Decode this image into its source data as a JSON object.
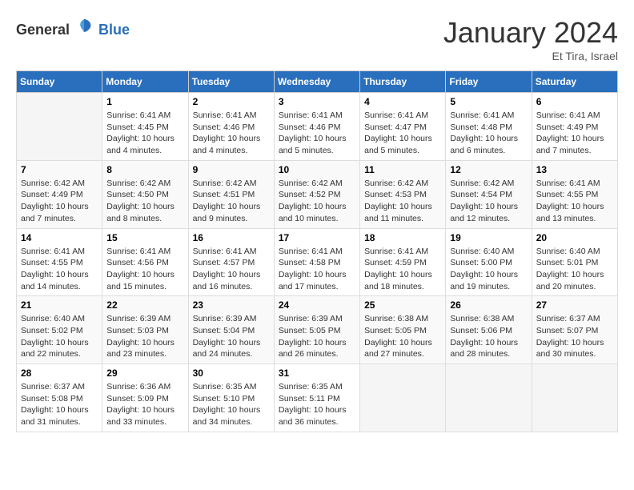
{
  "header": {
    "logo": {
      "general": "General",
      "blue": "Blue"
    },
    "title": "January 2024",
    "location": "Et Tira, Israel"
  },
  "calendar": {
    "columns": [
      "Sunday",
      "Monday",
      "Tuesday",
      "Wednesday",
      "Thursday",
      "Friday",
      "Saturday"
    ],
    "weeks": [
      [
        {
          "day": "",
          "info": ""
        },
        {
          "day": "1",
          "info": "Sunrise: 6:41 AM\nSunset: 4:45 PM\nDaylight: 10 hours\nand 4 minutes."
        },
        {
          "day": "2",
          "info": "Sunrise: 6:41 AM\nSunset: 4:46 PM\nDaylight: 10 hours\nand 4 minutes."
        },
        {
          "day": "3",
          "info": "Sunrise: 6:41 AM\nSunset: 4:46 PM\nDaylight: 10 hours\nand 5 minutes."
        },
        {
          "day": "4",
          "info": "Sunrise: 6:41 AM\nSunset: 4:47 PM\nDaylight: 10 hours\nand 5 minutes."
        },
        {
          "day": "5",
          "info": "Sunrise: 6:41 AM\nSunset: 4:48 PM\nDaylight: 10 hours\nand 6 minutes."
        },
        {
          "day": "6",
          "info": "Sunrise: 6:41 AM\nSunset: 4:49 PM\nDaylight: 10 hours\nand 7 minutes."
        }
      ],
      [
        {
          "day": "7",
          "info": "Sunrise: 6:42 AM\nSunset: 4:49 PM\nDaylight: 10 hours\nand 7 minutes."
        },
        {
          "day": "8",
          "info": "Sunrise: 6:42 AM\nSunset: 4:50 PM\nDaylight: 10 hours\nand 8 minutes."
        },
        {
          "day": "9",
          "info": "Sunrise: 6:42 AM\nSunset: 4:51 PM\nDaylight: 10 hours\nand 9 minutes."
        },
        {
          "day": "10",
          "info": "Sunrise: 6:42 AM\nSunset: 4:52 PM\nDaylight: 10 hours\nand 10 minutes."
        },
        {
          "day": "11",
          "info": "Sunrise: 6:42 AM\nSunset: 4:53 PM\nDaylight: 10 hours\nand 11 minutes."
        },
        {
          "day": "12",
          "info": "Sunrise: 6:42 AM\nSunset: 4:54 PM\nDaylight: 10 hours\nand 12 minutes."
        },
        {
          "day": "13",
          "info": "Sunrise: 6:41 AM\nSunset: 4:55 PM\nDaylight: 10 hours\nand 13 minutes."
        }
      ],
      [
        {
          "day": "14",
          "info": "Sunrise: 6:41 AM\nSunset: 4:55 PM\nDaylight: 10 hours\nand 14 minutes."
        },
        {
          "day": "15",
          "info": "Sunrise: 6:41 AM\nSunset: 4:56 PM\nDaylight: 10 hours\nand 15 minutes."
        },
        {
          "day": "16",
          "info": "Sunrise: 6:41 AM\nSunset: 4:57 PM\nDaylight: 10 hours\nand 16 minutes."
        },
        {
          "day": "17",
          "info": "Sunrise: 6:41 AM\nSunset: 4:58 PM\nDaylight: 10 hours\nand 17 minutes."
        },
        {
          "day": "18",
          "info": "Sunrise: 6:41 AM\nSunset: 4:59 PM\nDaylight: 10 hours\nand 18 minutes."
        },
        {
          "day": "19",
          "info": "Sunrise: 6:40 AM\nSunset: 5:00 PM\nDaylight: 10 hours\nand 19 minutes."
        },
        {
          "day": "20",
          "info": "Sunrise: 6:40 AM\nSunset: 5:01 PM\nDaylight: 10 hours\nand 20 minutes."
        }
      ],
      [
        {
          "day": "21",
          "info": "Sunrise: 6:40 AM\nSunset: 5:02 PM\nDaylight: 10 hours\nand 22 minutes."
        },
        {
          "day": "22",
          "info": "Sunrise: 6:39 AM\nSunset: 5:03 PM\nDaylight: 10 hours\nand 23 minutes."
        },
        {
          "day": "23",
          "info": "Sunrise: 6:39 AM\nSunset: 5:04 PM\nDaylight: 10 hours\nand 24 minutes."
        },
        {
          "day": "24",
          "info": "Sunrise: 6:39 AM\nSunset: 5:05 PM\nDaylight: 10 hours\nand 26 minutes."
        },
        {
          "day": "25",
          "info": "Sunrise: 6:38 AM\nSunset: 5:05 PM\nDaylight: 10 hours\nand 27 minutes."
        },
        {
          "day": "26",
          "info": "Sunrise: 6:38 AM\nSunset: 5:06 PM\nDaylight: 10 hours\nand 28 minutes."
        },
        {
          "day": "27",
          "info": "Sunrise: 6:37 AM\nSunset: 5:07 PM\nDaylight: 10 hours\nand 30 minutes."
        }
      ],
      [
        {
          "day": "28",
          "info": "Sunrise: 6:37 AM\nSunset: 5:08 PM\nDaylight: 10 hours\nand 31 minutes."
        },
        {
          "day": "29",
          "info": "Sunrise: 6:36 AM\nSunset: 5:09 PM\nDaylight: 10 hours\nand 33 minutes."
        },
        {
          "day": "30",
          "info": "Sunrise: 6:35 AM\nSunset: 5:10 PM\nDaylight: 10 hours\nand 34 minutes."
        },
        {
          "day": "31",
          "info": "Sunrise: 6:35 AM\nSunset: 5:11 PM\nDaylight: 10 hours\nand 36 minutes."
        },
        {
          "day": "",
          "info": ""
        },
        {
          "day": "",
          "info": ""
        },
        {
          "day": "",
          "info": ""
        }
      ]
    ]
  }
}
